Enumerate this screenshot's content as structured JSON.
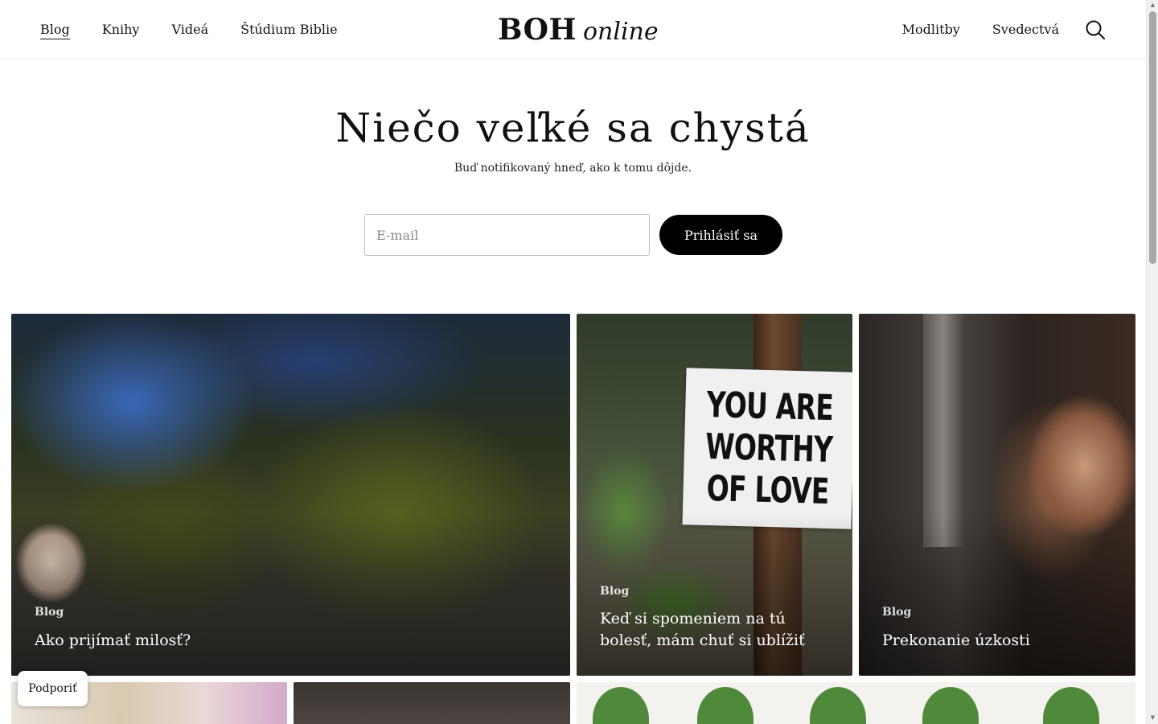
{
  "header": {
    "nav_left": [
      "Blog",
      "Knihy",
      "Videá",
      "Štúdium Biblie"
    ],
    "logo_bold": "BOH",
    "logo_italic": "online",
    "nav_right": [
      "Modlitby",
      "Svedectvá"
    ],
    "search_icon": "search-icon"
  },
  "hero": {
    "title": "Niečo veľké sa chystá",
    "subtitle": "Buď notifikovaný hneď, ako k tomu dôjde.",
    "email_placeholder": "E-mail",
    "subscribe_label": "Prihlásiť sa"
  },
  "posts": [
    {
      "category": "Blog",
      "title": "Ako prijímať milosť?"
    },
    {
      "category": "Blog",
      "title": "Keď si spomeniem na tú bolesť, mám chuť si ublížiť",
      "image_text": "YOU ARE WORTHY OF LOVE"
    },
    {
      "category": "Blog",
      "title": "Prekonanie úzkosti"
    }
  ],
  "support_label": "Podporiť",
  "colors": {
    "accent": "#000000",
    "text": "#111111",
    "border": "#bdbdbd"
  }
}
